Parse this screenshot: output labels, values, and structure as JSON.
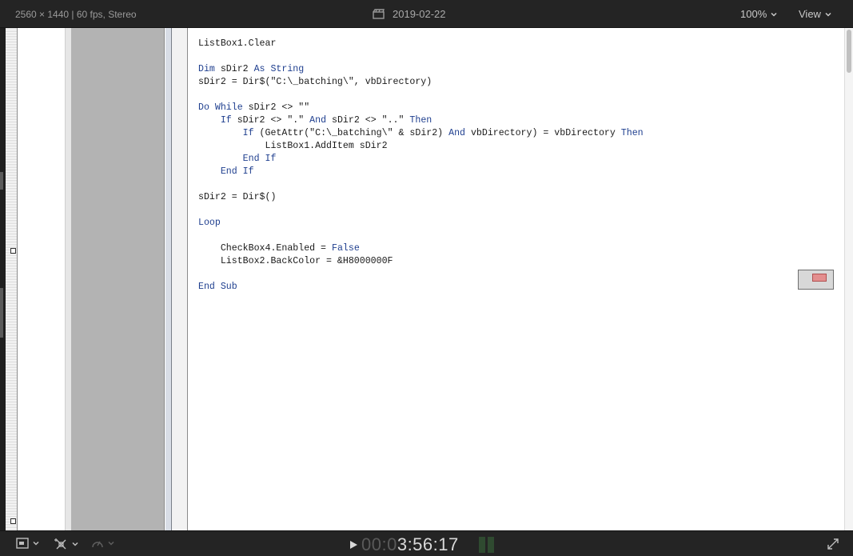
{
  "topbar": {
    "info": "2560 × 1440 | 60 fps, Stereo",
    "date": "2019-02-22",
    "zoom": "100%",
    "view": "View"
  },
  "code_lines": [
    [
      {
        "t": "ListBox1.Clear",
        "k": false
      }
    ],
    [
      {
        "t": "",
        "k": false
      }
    ],
    [
      {
        "t": "Dim",
        "k": true
      },
      {
        "t": " sDir2 ",
        "k": false
      },
      {
        "t": "As String",
        "k": true
      }
    ],
    [
      {
        "t": "sDir2 = Dir$(\"C:\\_batching\\\", vbDirectory)",
        "k": false
      }
    ],
    [
      {
        "t": "",
        "k": false
      }
    ],
    [
      {
        "t": "Do While",
        "k": true
      },
      {
        "t": " sDir2 <> \"\"",
        "k": false
      }
    ],
    [
      {
        "t": "    ",
        "k": false
      },
      {
        "t": "If",
        "k": true
      },
      {
        "t": " sDir2 <> \".\" ",
        "k": false
      },
      {
        "t": "And",
        "k": true
      },
      {
        "t": " sDir2 <> \"..\" ",
        "k": false
      },
      {
        "t": "Then",
        "k": true
      }
    ],
    [
      {
        "t": "        ",
        "k": false
      },
      {
        "t": "If",
        "k": true
      },
      {
        "t": " (GetAttr(\"C:\\_batching\\\" & sDir2) ",
        "k": false
      },
      {
        "t": "And",
        "k": true
      },
      {
        "t": " vbDirectory) = vbDirectory ",
        "k": false
      },
      {
        "t": "Then",
        "k": true
      }
    ],
    [
      {
        "t": "            ListBox1.AddItem sDir2",
        "k": false
      }
    ],
    [
      {
        "t": "        ",
        "k": false
      },
      {
        "t": "End If",
        "k": true
      }
    ],
    [
      {
        "t": "    ",
        "k": false
      },
      {
        "t": "End If",
        "k": true
      }
    ],
    [
      {
        "t": "",
        "k": false
      }
    ],
    [
      {
        "t": "sDir2 = Dir$()",
        "k": false
      }
    ],
    [
      {
        "t": "",
        "k": false
      }
    ],
    [
      {
        "t": "Loop",
        "k": true
      }
    ],
    [
      {
        "t": "",
        "k": false
      }
    ],
    [
      {
        "t": "    CheckBox4.Enabled = ",
        "k": false
      },
      {
        "t": "False",
        "k": true
      }
    ],
    [
      {
        "t": "    ListBox2.BackColor = &H8000000F",
        "k": false
      }
    ],
    [
      {
        "t": "",
        "k": false
      }
    ],
    [
      {
        "t": "End Sub",
        "k": true
      }
    ]
  ],
  "bottombar": {
    "timecode_dim": "00:0",
    "timecode_main": "3:56:17"
  },
  "colors": {
    "keyword": "#1f3f8f",
    "code_text": "#1a1a1a",
    "chrome_bg": "#242424"
  }
}
